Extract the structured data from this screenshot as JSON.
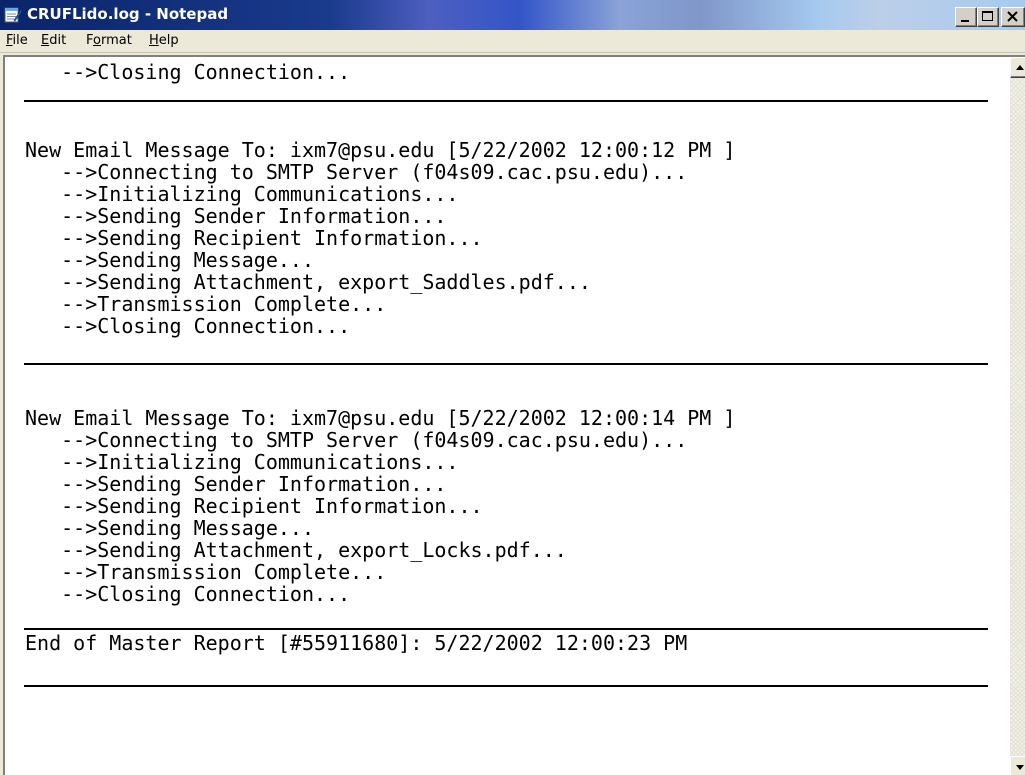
{
  "window": {
    "title": "CRUFLido.log - Notepad",
    "app_icon": "notepad-icon",
    "controls": [
      "minimize-icon",
      "maximize-icon",
      "close-icon"
    ]
  },
  "menu": {
    "file": {
      "mnemonic": "F",
      "rest": "ile"
    },
    "edit": {
      "mnemonic": "E",
      "rest": "dit"
    },
    "format": {
      "pre": "F",
      "mnemonic": "o",
      "rest": "rmat"
    },
    "help": {
      "mnemonic": "H",
      "rest": "elp"
    }
  },
  "document": {
    "lines": [
      "   -->Closing Connection...",
      "New Email Message To: ixm7@psu.edu [5/22/2002 12:00:12 PM ]",
      "   -->Connecting to SMTP Server (f04s09.cac.psu.edu)...",
      "   -->Initializing Communications...",
      "   -->Sending Sender Information...",
      "   -->Sending Recipient Information...",
      "   -->Sending Message...",
      "   -->Sending Attachment, export_Saddles.pdf...",
      "   -->Transmission Complete...",
      "   -->Closing Connection...",
      "New Email Message To: ixm7@psu.edu [5/22/2002 12:00:14 PM ]",
      "   -->Connecting to SMTP Server (f04s09.cac.psu.edu)...",
      "   -->Initializing Communications...",
      "   -->Sending Sender Information...",
      "   -->Sending Recipient Information...",
      "   -->Sending Message...",
      "   -->Sending Attachment, export_Locks.pdf...",
      "   -->Transmission Complete...",
      "   -->Closing Connection...",
      "End of Master Report [#55911680]: 5/22/2002 12:00:23 PM"
    ]
  },
  "scrollbar": {
    "up_icon": "scroll-up-arrow-icon",
    "down_icon": "scroll-down-arrow-icon"
  }
}
